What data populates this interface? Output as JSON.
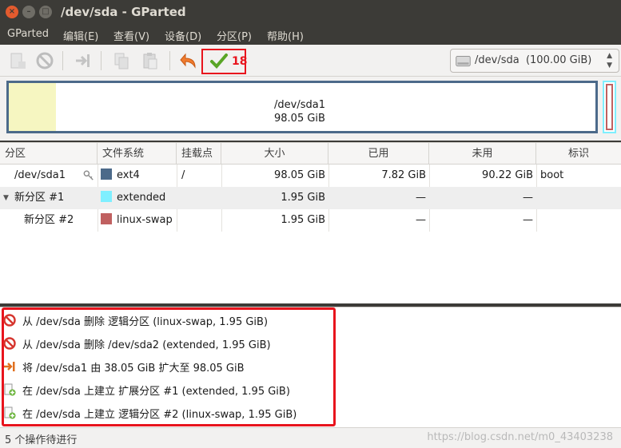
{
  "window": {
    "title": "/dev/sda - GParted",
    "close_glyph": "×",
    "min_glyph": "–",
    "max_glyph": "□"
  },
  "menu": [
    {
      "label": "GParted"
    },
    {
      "label": "编辑(E)"
    },
    {
      "label": "查看(V)"
    },
    {
      "label": "设备(D)"
    },
    {
      "label": "分区(P)"
    },
    {
      "label": "帮助(H)"
    }
  ],
  "toolbar": {
    "icons": [
      "new-partition-icon",
      "delete-icon",
      "resize-move-icon",
      "copy-icon",
      "paste-icon",
      "undo-icon",
      "apply-icon"
    ],
    "pending_count": "18",
    "device": {
      "label": "/dev/sda  (100.00 GiB)",
      "icon": "hard-disk-icon",
      "arrow_up": "▲",
      "arrow_down": "▼"
    }
  },
  "disk_visual": {
    "partition_name": "/dev/sda1",
    "partition_size": "98.05 GiB",
    "used_fraction": 0.08,
    "colors": {
      "ext4_border": "#4c6a8a",
      "used_fill": "#f6f6c1",
      "extended_border": "#7fefff",
      "swap_border": "#c06060"
    }
  },
  "table": {
    "headers": {
      "partition": "分区",
      "filesystem": "文件系统",
      "mount": "挂载点",
      "size": "大小",
      "used": "已用",
      "unused": "未用",
      "flags": "标识"
    },
    "rows": [
      {
        "partition": "/dev/sda1",
        "fs": "ext4",
        "fs_color": "#4c6a8a",
        "mount": "/",
        "size": "98.05 GiB",
        "used": "7.82 GiB",
        "unused": "90.22 GiB",
        "flags": "boot"
      },
      {
        "partition": "新分区 #1",
        "fs": "extended",
        "fs_color": "#7fefff",
        "mount": "",
        "size": "1.95 GiB",
        "used": "—",
        "unused": "—",
        "flags": "",
        "expander": "▼"
      },
      {
        "partition": "新分区 #2",
        "fs": "linux-swap",
        "fs_color": "#c06060",
        "mount": "",
        "size": "1.95 GiB",
        "used": "—",
        "unused": "—",
        "flags": ""
      }
    ]
  },
  "operations": [
    {
      "icon": "delete-icon",
      "text": "从 /dev/sda 删除 逻辑分区 (linux-swap, 1.95 GiB)"
    },
    {
      "icon": "delete-icon",
      "text": "从 /dev/sda 删除 /dev/sda2 (extended, 1.95 GiB)"
    },
    {
      "icon": "resize-move-icon",
      "text": "将 /dev/sda1 由 38.05 GiB 扩大至 98.05 GiB"
    },
    {
      "icon": "new-partition-icon",
      "text": "在 /dev/sda 上建立 扩展分区 #1 (extended, 1.95 GiB)"
    },
    {
      "icon": "new-partition-icon",
      "text": "在 /dev/sda 上建立 逻辑分区 #2 (linux-swap, 1.95 GiB)"
    }
  ],
  "status": {
    "text": "5 个操作待进行",
    "watermark": "https://blog.csdn.net/m0_43403238"
  }
}
